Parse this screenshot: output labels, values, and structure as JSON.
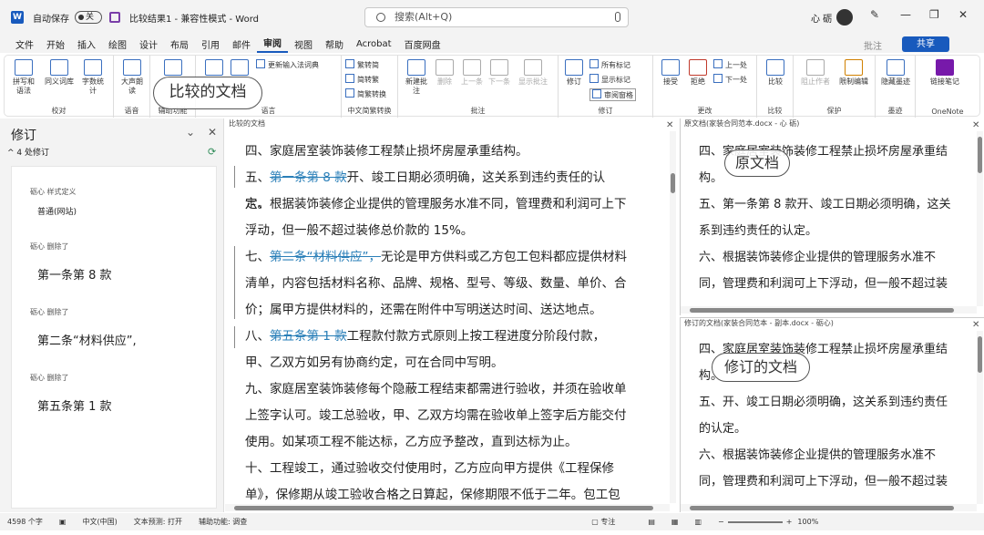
{
  "titlebar": {
    "autosave_label": "自动保存",
    "autosave_state": "关",
    "doc_title": "比较结果1 - 兼容性模式 - Word",
    "search_placeholder": "搜索(Alt+Q)",
    "user_name": "心 砺"
  },
  "menu": {
    "items": [
      "文件",
      "开始",
      "插入",
      "绘图",
      "设计",
      "布局",
      "引用",
      "邮件",
      "审阅",
      "视图",
      "帮助",
      "Acrobat",
      "百度网盘"
    ],
    "comment_label": "批注",
    "share_label": "共享"
  },
  "ribbon": {
    "proofing": {
      "label": "校对",
      "spell": "拼写和语法",
      "thesaurus": "同义词库",
      "wordcount": "字数统计"
    },
    "speech": {
      "label": "语音",
      "read": "大声朗读"
    },
    "accessibility": {
      "label": "辅助功能"
    },
    "language": {
      "label": "语言",
      "update_ime": "更新输入法词典"
    },
    "chinese": {
      "label": "中文简繁转换",
      "to_trad": "繁转简",
      "to_simp": "简转繁",
      "convert": "简繁转换"
    },
    "comments": {
      "label": "批注",
      "new": "新建批注",
      "delete": "删除",
      "prev": "上一条",
      "next": "下一条",
      "show": "显示批注"
    },
    "tracking": {
      "label": "修订",
      "track": "修订",
      "all_markup": "所有标记",
      "show_markup": "显示标记",
      "pane": "审阅窗格"
    },
    "changes": {
      "label": "更改",
      "accept": "接受",
      "reject": "拒绝",
      "prev": "上一处",
      "next": "下一处"
    },
    "compare": {
      "label": "比较",
      "compare": "比较"
    },
    "protect": {
      "label": "保护",
      "block": "阻止作者",
      "restrict": "限制编辑"
    },
    "ink": {
      "label": "墨迹",
      "hide": "隐藏墨迹"
    },
    "onenote": {
      "label": "OneNote",
      "link": "链接笔记"
    }
  },
  "callouts": {
    "compared": "比较的文档",
    "original": "原文档",
    "revised": "修订的文档"
  },
  "revisions_pane": {
    "title": "修订",
    "count": "4 处修订",
    "items": [
      {
        "author": "砺心 样式定义",
        "text": "普通(网站)"
      },
      {
        "author": "砺心 删除了",
        "text": "第一条第 8 款"
      },
      {
        "author": "砺心 删除了",
        "text": "第二条“材料供应”,"
      },
      {
        "author": "砺心 删除了",
        "text": "第五条第 1 款"
      }
    ]
  },
  "compared_doc": {
    "header": "比较的文档",
    "paragraphs": [
      {
        "pre": "",
        "ins": "",
        "text": "四、家庭居室装饰装修工程禁止损坏房屋承重结构。"
      },
      {
        "pre": "五、",
        "ins": "第一条第 8 款",
        "text": "开、竣工日期必须明确，这关系到违约责任的认定。"
      },
      {
        "pre": "",
        "ins": "",
        "text": "六、根据装饰装修企业提供的管理服务水准不同，管理费和利润可上下浮动，但一般不超过装修总价款的 15%。"
      },
      {
        "pre": "七、",
        "ins": "第二条“材料供应”，",
        "text": "无论是甲方供料或乙方包工包料都应提供材料清单，内容包括材料名称、品牌、规格、型号、等级、数量、单价、合价；属甲方提供材料的，还需在附件中写明送达时间、送达地点。"
      },
      {
        "pre": "八、",
        "ins": "第五条第 1 款",
        "text": "工程款付款方式原则上按工程进度分阶段付款，甲、乙双方如另有协商约定，可在合同中写明。"
      },
      {
        "pre": "",
        "ins": "",
        "text": "九、家庭居室装饰装修每个隐蔽工程结束都需进行验收，并须在验收单上签字认可。竣工总验收，甲、乙双方均需在验收单上签字后方能交付使用。如某项工程不能达标，乙方应予整改，直到达标为止。"
      },
      {
        "pre": "",
        "ins": "",
        "text": "十、工程竣工，通过验收交付使用时，乙方应向甲方提供《工程保修单》，保修期从竣工验收合格之日算起，保修期限不低于二年。包工包料的工程对"
      }
    ]
  },
  "original_doc": {
    "header": "原文档(家装合同范本.docx - 心 砺)",
    "paragraphs": [
      "四、家庭居室装饰装修工程禁止损坏房屋承重结构。",
      "五、第一条第 8 款开、竣工日期必须明确，这关系到违约责任的认定。",
      "六、根据装饰装修企业提供的管理服务水准不同，管理费和利润可上下浮动，但一般不超过装"
    ]
  },
  "revised_doc": {
    "header": "修订的文档(家装合同范本 - 副本.docx - 砺心)",
    "paragraphs": [
      "四、家庭居室装饰装修工程禁止损坏房屋承重结构。",
      "五、开、竣工日期必须明确，这关系到违约责任的认定。",
      "六、根据装饰装修企业提供的管理服务水准不同，管理费和利润可上下浮动，但一般不超过装"
    ]
  },
  "status": {
    "words": "4598 个字",
    "lang": "中文(中国)",
    "predict": "文本预测: 打开",
    "access": "辅助功能: 调查",
    "focus": "专注",
    "zoom": "100%"
  }
}
